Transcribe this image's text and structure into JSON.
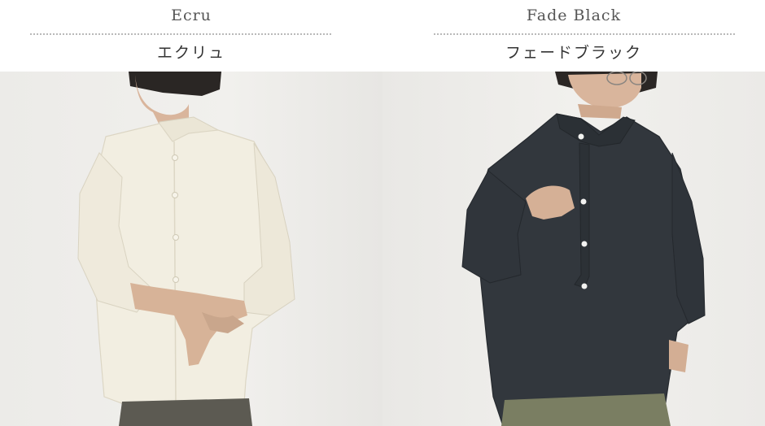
{
  "variants": [
    {
      "name_en": "Ecru",
      "name_ja": "エクリュ",
      "shirt_color": "#f2eee1"
    },
    {
      "name_en": "Fade Black",
      "name_ja": "フェードブラック",
      "shirt_color": "#32373d"
    }
  ]
}
